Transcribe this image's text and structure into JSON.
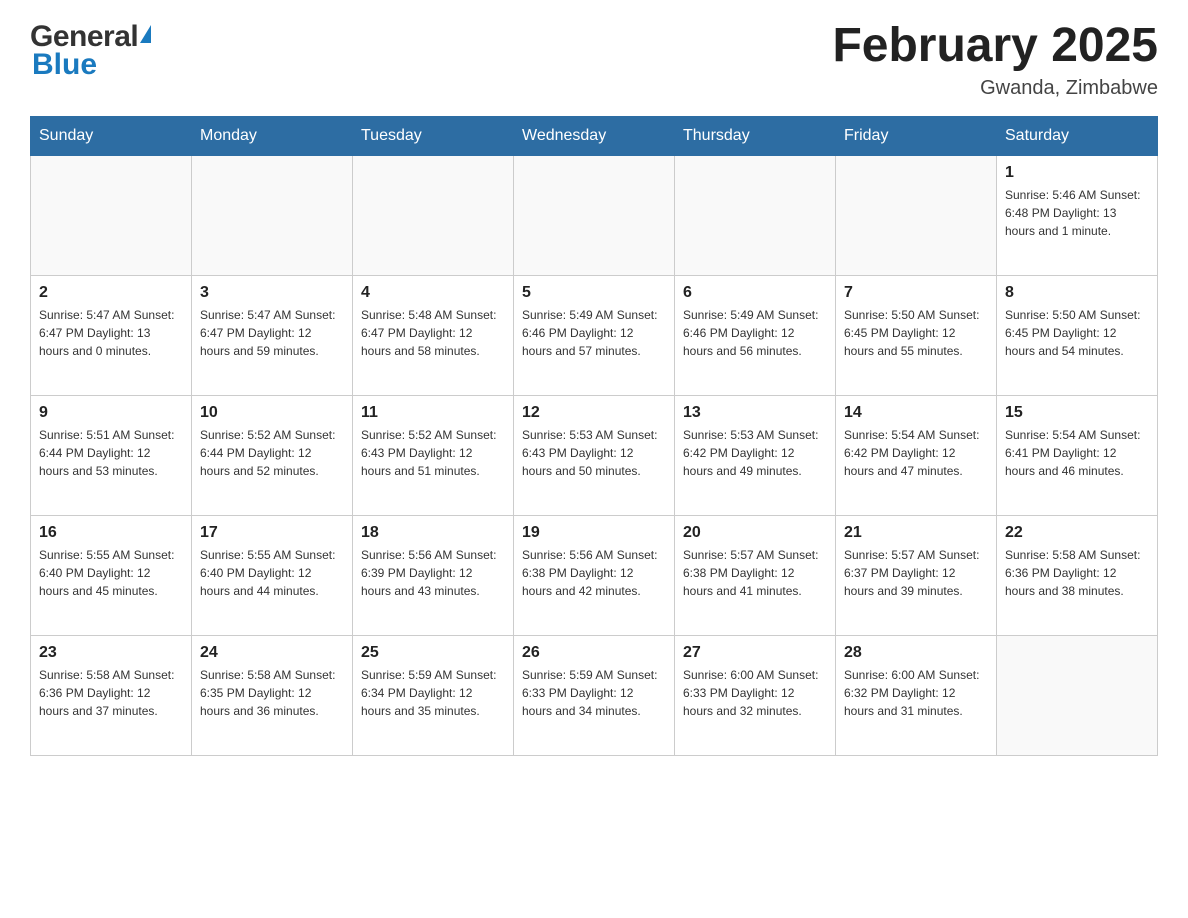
{
  "header": {
    "logo_general": "General",
    "logo_blue": "Blue",
    "month_title": "February 2025",
    "location": "Gwanda, Zimbabwe"
  },
  "days_of_week": [
    "Sunday",
    "Monday",
    "Tuesday",
    "Wednesday",
    "Thursday",
    "Friday",
    "Saturday"
  ],
  "weeks": [
    [
      {
        "day": "",
        "info": ""
      },
      {
        "day": "",
        "info": ""
      },
      {
        "day": "",
        "info": ""
      },
      {
        "day": "",
        "info": ""
      },
      {
        "day": "",
        "info": ""
      },
      {
        "day": "",
        "info": ""
      },
      {
        "day": "1",
        "info": "Sunrise: 5:46 AM\nSunset: 6:48 PM\nDaylight: 13 hours\nand 1 minute."
      }
    ],
    [
      {
        "day": "2",
        "info": "Sunrise: 5:47 AM\nSunset: 6:47 PM\nDaylight: 13 hours\nand 0 minutes."
      },
      {
        "day": "3",
        "info": "Sunrise: 5:47 AM\nSunset: 6:47 PM\nDaylight: 12 hours\nand 59 minutes."
      },
      {
        "day": "4",
        "info": "Sunrise: 5:48 AM\nSunset: 6:47 PM\nDaylight: 12 hours\nand 58 minutes."
      },
      {
        "day": "5",
        "info": "Sunrise: 5:49 AM\nSunset: 6:46 PM\nDaylight: 12 hours\nand 57 minutes."
      },
      {
        "day": "6",
        "info": "Sunrise: 5:49 AM\nSunset: 6:46 PM\nDaylight: 12 hours\nand 56 minutes."
      },
      {
        "day": "7",
        "info": "Sunrise: 5:50 AM\nSunset: 6:45 PM\nDaylight: 12 hours\nand 55 minutes."
      },
      {
        "day": "8",
        "info": "Sunrise: 5:50 AM\nSunset: 6:45 PM\nDaylight: 12 hours\nand 54 minutes."
      }
    ],
    [
      {
        "day": "9",
        "info": "Sunrise: 5:51 AM\nSunset: 6:44 PM\nDaylight: 12 hours\nand 53 minutes."
      },
      {
        "day": "10",
        "info": "Sunrise: 5:52 AM\nSunset: 6:44 PM\nDaylight: 12 hours\nand 52 minutes."
      },
      {
        "day": "11",
        "info": "Sunrise: 5:52 AM\nSunset: 6:43 PM\nDaylight: 12 hours\nand 51 minutes."
      },
      {
        "day": "12",
        "info": "Sunrise: 5:53 AM\nSunset: 6:43 PM\nDaylight: 12 hours\nand 50 minutes."
      },
      {
        "day": "13",
        "info": "Sunrise: 5:53 AM\nSunset: 6:42 PM\nDaylight: 12 hours\nand 49 minutes."
      },
      {
        "day": "14",
        "info": "Sunrise: 5:54 AM\nSunset: 6:42 PM\nDaylight: 12 hours\nand 47 minutes."
      },
      {
        "day": "15",
        "info": "Sunrise: 5:54 AM\nSunset: 6:41 PM\nDaylight: 12 hours\nand 46 minutes."
      }
    ],
    [
      {
        "day": "16",
        "info": "Sunrise: 5:55 AM\nSunset: 6:40 PM\nDaylight: 12 hours\nand 45 minutes."
      },
      {
        "day": "17",
        "info": "Sunrise: 5:55 AM\nSunset: 6:40 PM\nDaylight: 12 hours\nand 44 minutes."
      },
      {
        "day": "18",
        "info": "Sunrise: 5:56 AM\nSunset: 6:39 PM\nDaylight: 12 hours\nand 43 minutes."
      },
      {
        "day": "19",
        "info": "Sunrise: 5:56 AM\nSunset: 6:38 PM\nDaylight: 12 hours\nand 42 minutes."
      },
      {
        "day": "20",
        "info": "Sunrise: 5:57 AM\nSunset: 6:38 PM\nDaylight: 12 hours\nand 41 minutes."
      },
      {
        "day": "21",
        "info": "Sunrise: 5:57 AM\nSunset: 6:37 PM\nDaylight: 12 hours\nand 39 minutes."
      },
      {
        "day": "22",
        "info": "Sunrise: 5:58 AM\nSunset: 6:36 PM\nDaylight: 12 hours\nand 38 minutes."
      }
    ],
    [
      {
        "day": "23",
        "info": "Sunrise: 5:58 AM\nSunset: 6:36 PM\nDaylight: 12 hours\nand 37 minutes."
      },
      {
        "day": "24",
        "info": "Sunrise: 5:58 AM\nSunset: 6:35 PM\nDaylight: 12 hours\nand 36 minutes."
      },
      {
        "day": "25",
        "info": "Sunrise: 5:59 AM\nSunset: 6:34 PM\nDaylight: 12 hours\nand 35 minutes."
      },
      {
        "day": "26",
        "info": "Sunrise: 5:59 AM\nSunset: 6:33 PM\nDaylight: 12 hours\nand 34 minutes."
      },
      {
        "day": "27",
        "info": "Sunrise: 6:00 AM\nSunset: 6:33 PM\nDaylight: 12 hours\nand 32 minutes."
      },
      {
        "day": "28",
        "info": "Sunrise: 6:00 AM\nSunset: 6:32 PM\nDaylight: 12 hours\nand 31 minutes."
      },
      {
        "day": "",
        "info": ""
      }
    ]
  ]
}
